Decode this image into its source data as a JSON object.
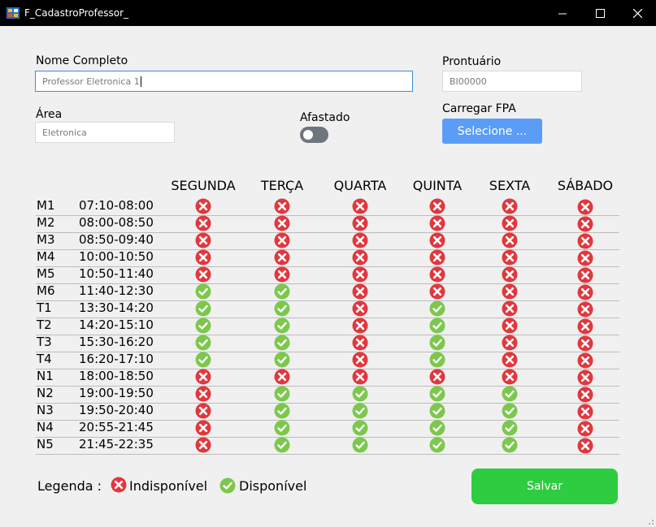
{
  "window": {
    "title": "F_CadastroProfessor_",
    "minimize": "—",
    "maximize": "☐",
    "close": "✕"
  },
  "form": {
    "nome_label": "Nome Completo",
    "nome_value": "Professor Eletronica 1",
    "prontuario_label": "Prontuário",
    "prontuario_value": "BI00000",
    "area_label": "Área",
    "area_value": "Eletronica",
    "afastado_label": "Afastado",
    "afastado_on": false,
    "carregar_label": "Carregar FPA",
    "selecione_label": "Selecione ..."
  },
  "schedule": {
    "days": [
      "SEGUNDA",
      "TERÇA",
      "QUARTA",
      "QUINTA",
      "SEXTA",
      "SÁBADO"
    ],
    "rows": [
      {
        "slot": "M1",
        "time": "07:10-08:00",
        "avail": [
          0,
          0,
          0,
          0,
          0,
          0
        ]
      },
      {
        "slot": "M2",
        "time": "08:00-08:50",
        "avail": [
          0,
          0,
          0,
          0,
          0,
          0
        ]
      },
      {
        "slot": "M3",
        "time": "08:50-09:40",
        "avail": [
          0,
          0,
          0,
          0,
          0,
          0
        ]
      },
      {
        "slot": "M4",
        "time": "10:00-10:50",
        "avail": [
          0,
          0,
          0,
          0,
          0,
          0
        ]
      },
      {
        "slot": "M5",
        "time": "10:50-11:40",
        "avail": [
          0,
          0,
          0,
          0,
          0,
          0
        ]
      },
      {
        "slot": "M6",
        "time": "11:40-12:30",
        "avail": [
          1,
          1,
          0,
          0,
          0,
          0
        ]
      },
      {
        "slot": "T1",
        "time": "13:30-14:20",
        "avail": [
          1,
          1,
          0,
          1,
          0,
          0
        ]
      },
      {
        "slot": "T2",
        "time": "14:20-15:10",
        "avail": [
          1,
          1,
          0,
          1,
          0,
          0
        ]
      },
      {
        "slot": "T3",
        "time": "15:30-16:20",
        "avail": [
          1,
          1,
          0,
          1,
          0,
          0
        ]
      },
      {
        "slot": "T4",
        "time": "16:20-17:10",
        "avail": [
          1,
          1,
          0,
          1,
          0,
          0
        ]
      },
      {
        "slot": "N1",
        "time": "18:00-18:50",
        "avail": [
          0,
          0,
          0,
          0,
          0,
          0
        ]
      },
      {
        "slot": "N2",
        "time": "19:00-19:50",
        "avail": [
          0,
          1,
          1,
          1,
          1,
          0
        ]
      },
      {
        "slot": "N3",
        "time": "19:50-20:40",
        "avail": [
          0,
          1,
          1,
          1,
          1,
          0
        ]
      },
      {
        "slot": "N4",
        "time": "20:55-21:45",
        "avail": [
          0,
          1,
          1,
          1,
          1,
          0
        ]
      },
      {
        "slot": "N5",
        "time": "21:45-22:35",
        "avail": [
          0,
          1,
          1,
          1,
          1,
          0
        ]
      }
    ]
  },
  "legend": {
    "label": "Legenda :",
    "unavailable": "Indisponível",
    "available": "Disponível"
  },
  "actions": {
    "save": "Salvar"
  },
  "colors": {
    "unavailable": "#e0383e",
    "available": "#7cc84d",
    "primary_button": "#5b9df6",
    "save_button": "#2ecc40"
  }
}
